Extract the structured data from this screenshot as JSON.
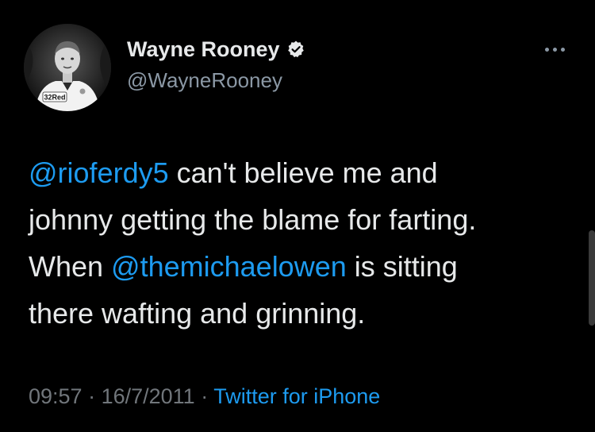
{
  "author": {
    "display_name": "Wayne Rooney",
    "handle": "@WayneRooney",
    "verified": true,
    "avatar_shirt_text": "32Red"
  },
  "tweet": {
    "lines": [
      [
        {
          "type": "mention",
          "text": "@rioferdy5"
        },
        {
          "type": "text",
          "text": " can't believe me and"
        }
      ],
      [
        {
          "type": "text",
          "text": "johnny getting the blame for farting."
        }
      ],
      [
        {
          "type": "text",
          "text": "When "
        },
        {
          "type": "mention",
          "text": "@themichaelowen"
        },
        {
          "type": "text",
          "text": " is sitting"
        }
      ],
      [
        {
          "type": "text",
          "text": "there wafting and grinning."
        }
      ]
    ]
  },
  "meta": {
    "time": "09:57",
    "separator": " · ",
    "date": "16/7/2011",
    "source": "Twitter for iPhone"
  },
  "colors": {
    "background": "#000000",
    "text": "#e7e9ea",
    "secondary": "#8b98a5",
    "link": "#1d9bf0",
    "verified_badge": "#e7e9ea"
  },
  "icons": {
    "verified": "verified-badge-icon",
    "more": "more-options-icon"
  }
}
